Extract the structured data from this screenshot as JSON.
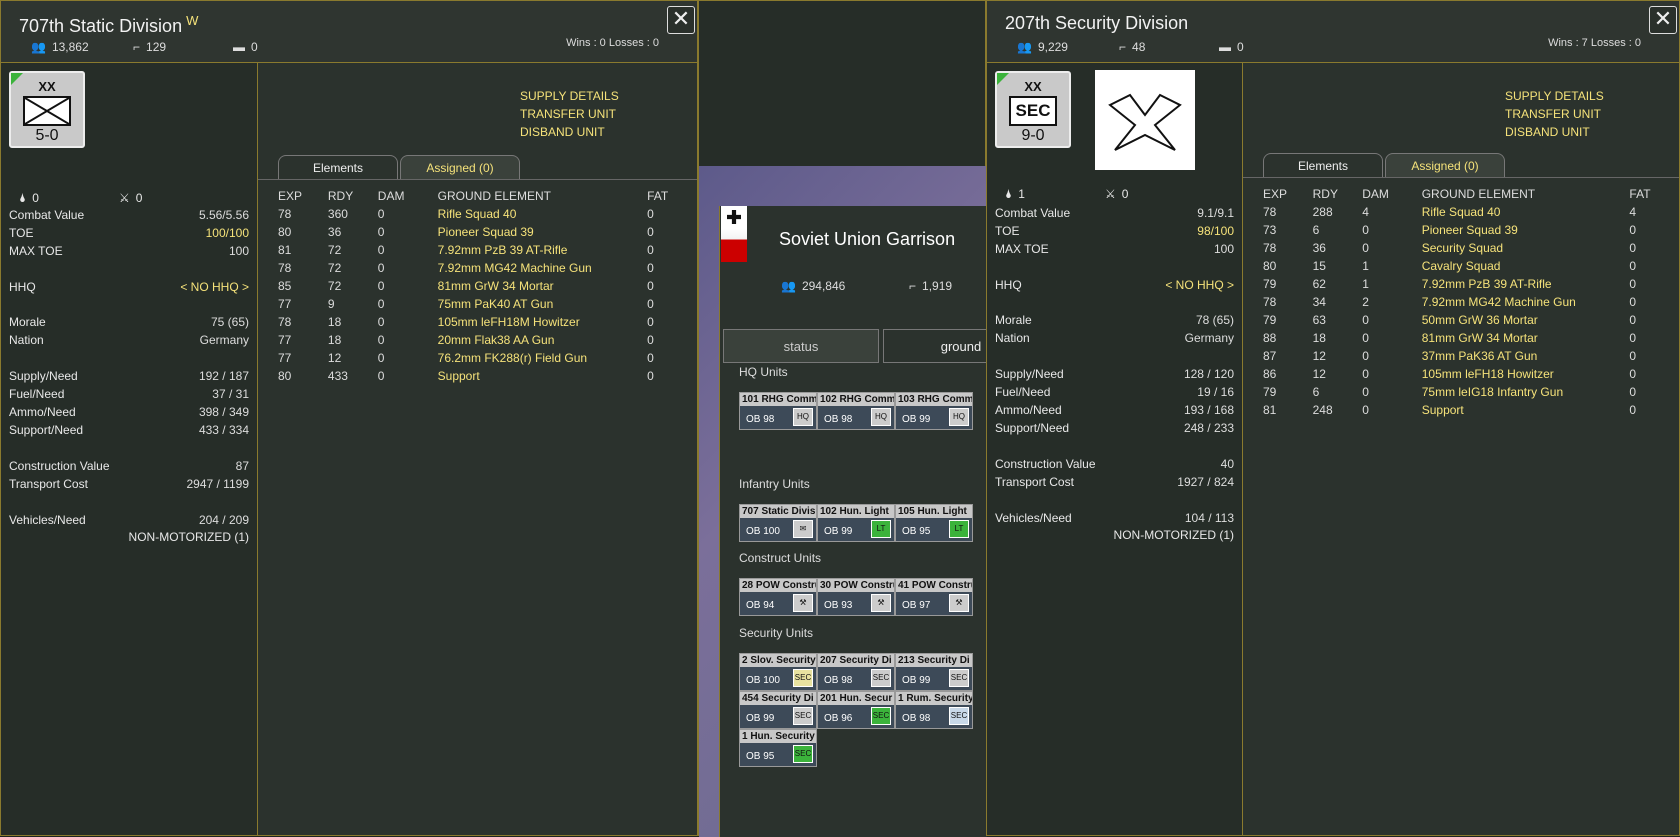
{
  "left": {
    "title": "707th Static Division",
    "title_sup": "W",
    "men": "13,862",
    "guns": "129",
    "tanks": "0",
    "winloss": "Wins : 0  Losses : 0",
    "counter": {
      "size": "XX",
      "strength": "5-0"
    },
    "crossed": "0",
    "symbol": "0",
    "stats": [
      {
        "k": "Combat Value",
        "v": "5.56/5.56",
        "y": false
      },
      {
        "k": "TOE",
        "v": "100/100",
        "y": true
      },
      {
        "k": "MAX TOE",
        "v": "100",
        "y": false
      },
      {
        "k": "HHQ",
        "v": "< NO HHQ >",
        "y": true
      },
      {
        "k": "Morale",
        "v": "75 (65)",
        "y": false
      },
      {
        "k": "Nation",
        "v": "Germany",
        "y": false
      },
      {
        "k": "Supply/Need",
        "v": "192 / 187",
        "y": false
      },
      {
        "k": "Fuel/Need",
        "v": "37 / 31",
        "y": false
      },
      {
        "k": "Ammo/Need",
        "v": "398 / 349",
        "y": false
      },
      {
        "k": "Support/Need",
        "v": "433 / 334",
        "y": false
      },
      {
        "k": "Construction Value",
        "v": "87",
        "y": false
      },
      {
        "k": "Transport Cost",
        "v": "2947 / 1199",
        "y": false
      },
      {
        "k": "Vehicles/Need",
        "v": "204 / 209",
        "y": false
      }
    ],
    "motor": "NON-MOTORIZED (1)",
    "menu": [
      "SUPPLY DETAILS",
      "TRANSFER UNIT",
      "DISBAND UNIT"
    ],
    "tabs": [
      "Elements",
      "Assigned (0)"
    ],
    "headers": [
      "EXP",
      "RDY",
      "DAM",
      "GROUND ELEMENT",
      "FAT"
    ],
    "rows": [
      [
        "78",
        "360",
        "0",
        "Rifle Squad 40",
        "0"
      ],
      [
        "80",
        "36",
        "0",
        "Pioneer Squad 39",
        "0"
      ],
      [
        "81",
        "72",
        "0",
        "7.92mm PzB 39 AT-Rifle",
        "0"
      ],
      [
        "78",
        "72",
        "0",
        "7.92mm MG42 Machine Gun",
        "0"
      ],
      [
        "85",
        "72",
        "0",
        "81mm GrW 34 Mortar",
        "0"
      ],
      [
        "77",
        "9",
        "0",
        "75mm PaK40 AT Gun",
        "0"
      ],
      [
        "78",
        "18",
        "0",
        "105mm leFH18M Howitzer",
        "0"
      ],
      [
        "77",
        "18",
        "0",
        "20mm Flak38 AA Gun",
        "0"
      ],
      [
        "77",
        "12",
        "0",
        "76.2mm FK288(r) Field Gun",
        "0"
      ],
      [
        "80",
        "433",
        "0",
        "Support",
        "0"
      ]
    ]
  },
  "right": {
    "title": "207th Security Division",
    "men": "9,229",
    "guns": "48",
    "tanks": "0",
    "winloss": "Wins : 7  Losses : 0",
    "counter": {
      "size": "XX",
      "sym": "SEC",
      "strength": "9-0"
    },
    "crossed": "1",
    "symbol": "0",
    "stats": [
      {
        "k": "Combat Value",
        "v": "9.1/9.1",
        "y": false
      },
      {
        "k": "TOE",
        "v": "98/100",
        "y": true
      },
      {
        "k": "MAX TOE",
        "v": "100",
        "y": false
      },
      {
        "k": "HHQ",
        "v": "< NO HHQ >",
        "y": true
      },
      {
        "k": "Morale",
        "v": "78 (65)",
        "y": false
      },
      {
        "k": "Nation",
        "v": "Germany",
        "y": false
      },
      {
        "k": "Supply/Need",
        "v": "128 / 120",
        "y": false
      },
      {
        "k": "Fuel/Need",
        "v": "19 / 16",
        "y": false
      },
      {
        "k": "Ammo/Need",
        "v": "193 / 168",
        "y": false
      },
      {
        "k": "Support/Need",
        "v": "248 / 233",
        "y": false
      },
      {
        "k": "Construction Value",
        "v": "40",
        "y": false
      },
      {
        "k": "Transport Cost",
        "v": "1927 / 824",
        "y": false
      },
      {
        "k": "Vehicles/Need",
        "v": "104 / 113",
        "y": false
      }
    ],
    "motor": "NON-MOTORIZED (1)",
    "menu": [
      "SUPPLY DETAILS",
      "TRANSFER UNIT",
      "DISBAND UNIT"
    ],
    "tabs": [
      "Elements",
      "Assigned (0)"
    ],
    "headers": [
      "EXP",
      "RDY",
      "DAM",
      "GROUND ELEMENT",
      "FAT"
    ],
    "rows": [
      [
        "78",
        "288",
        "4",
        "Rifle Squad 40",
        "4"
      ],
      [
        "73",
        "6",
        "0",
        "Pioneer Squad 39",
        "0"
      ],
      [
        "78",
        "36",
        "0",
        "Security Squad",
        "0"
      ],
      [
        "80",
        "15",
        "1",
        "Cavalry Squad",
        "0"
      ],
      [
        "79",
        "62",
        "1",
        "7.92mm PzB 39 AT-Rifle",
        "0"
      ],
      [
        "78",
        "34",
        "2",
        "7.92mm MG42 Machine Gun",
        "0"
      ],
      [
        "79",
        "63",
        "0",
        "50mm GrW 36 Mortar",
        "0"
      ],
      [
        "88",
        "18",
        "0",
        "81mm GrW 34 Mortar",
        "0"
      ],
      [
        "87",
        "12",
        "0",
        "37mm PaK36 AT Gun",
        "0"
      ],
      [
        "86",
        "12",
        "0",
        "105mm leFH18 Howitzer",
        "0"
      ],
      [
        "79",
        "6",
        "0",
        "75mm leIG18 Infantry Gun",
        "0"
      ],
      [
        "81",
        "248",
        "0",
        "Support",
        "0"
      ]
    ]
  },
  "garrison": {
    "title": "Soviet Union Garrison",
    "men": "294,846",
    "guns": "1,919",
    "tabs": [
      "status",
      "ground"
    ],
    "sections": [
      {
        "name": "HQ Units",
        "units": [
          {
            "n": "101 RHG Comm",
            "ob": "OB 98",
            "i": "HQ",
            "c": ""
          },
          {
            "n": "102 RHG Comm",
            "ob": "OB 98",
            "i": "HQ",
            "c": ""
          },
          {
            "n": "103 RHG Comm",
            "ob": "OB 99",
            "i": "HQ",
            "c": ""
          }
        ]
      },
      {
        "name": "Infantry Units",
        "units": [
          {
            "n": "707 Static Divis",
            "ob": "OB 100",
            "i": "✉",
            "c": ""
          },
          {
            "n": "102 Hun. Light",
            "ob": "OB 99",
            "i": "LT",
            "c": "grn"
          },
          {
            "n": "105 Hun. Light",
            "ob": "OB 95",
            "i": "LT",
            "c": "grn"
          }
        ]
      },
      {
        "name": "Construct Units",
        "units": [
          {
            "n": "28 POW Constru",
            "ob": "OB 94",
            "i": "⚒",
            "c": ""
          },
          {
            "n": "30 POW Constru",
            "ob": "OB 93",
            "i": "⚒",
            "c": ""
          },
          {
            "n": "41 POW Constru",
            "ob": "OB 97",
            "i": "⚒",
            "c": ""
          }
        ]
      },
      {
        "name": "Security Units",
        "units": [
          {
            "n": "2 Slov. Security",
            "ob": "OB 100",
            "i": "SEC",
            "c": "yel"
          },
          {
            "n": "207 Security Di",
            "ob": "OB 98",
            "i": "SEC",
            "c": ""
          },
          {
            "n": "213 Security Di",
            "ob": "OB 99",
            "i": "SEC",
            "c": ""
          },
          {
            "n": "454 Security Di",
            "ob": "OB 99",
            "i": "SEC",
            "c": ""
          },
          {
            "n": "201 Hun. Secur",
            "ob": "OB 96",
            "i": "SEC",
            "c": "grn"
          },
          {
            "n": "1 Rum. Security",
            "ob": "OB 98",
            "i": "SEC",
            "c": "lb"
          },
          {
            "n": "1 Hun. Security",
            "ob": "OB 95",
            "i": "SEC",
            "c": "grn"
          }
        ]
      }
    ]
  },
  "icons": [
    "people-icon",
    "gun-icon",
    "tank-icon",
    "close-icon",
    "drop-icon",
    "crossed-swords-icon"
  ],
  "colors": {
    "accent": "#f5e27a",
    "border": "#8a7a2e",
    "panel": "#2b322d"
  }
}
